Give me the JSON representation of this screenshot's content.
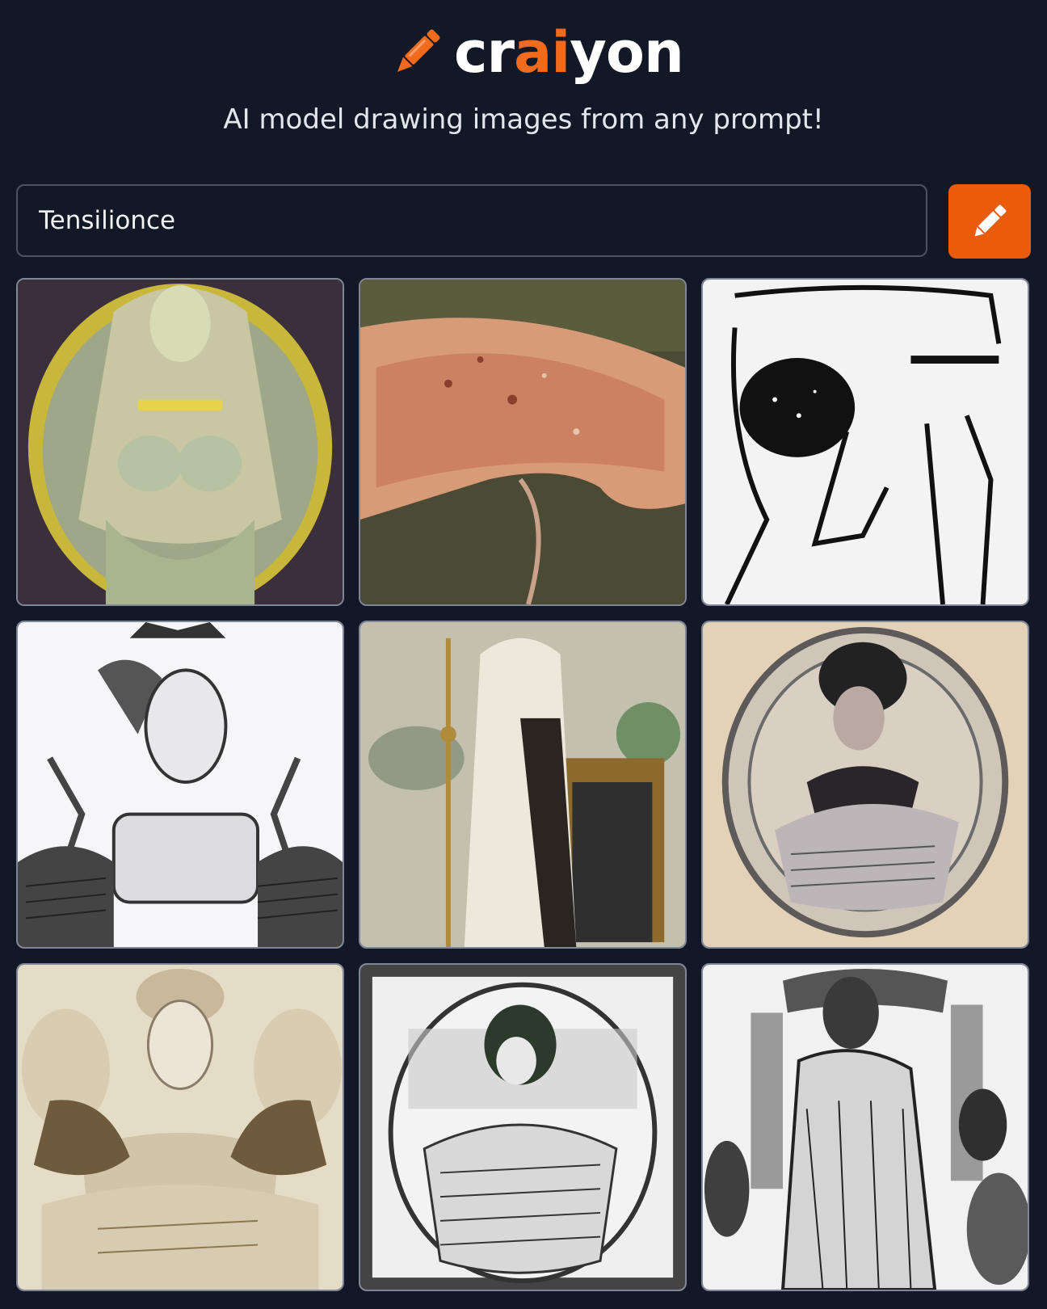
{
  "app": {
    "brand_prefix": "cr",
    "brand_accent": "ai",
    "brand_suffix": "yon",
    "tagline": "AI model drawing images from any prompt!",
    "logo_icon": "crayon-icon"
  },
  "search": {
    "value": "Tensilionce",
    "placeholder": "",
    "button_icon": "pencil-icon"
  },
  "colors": {
    "background": "#121826",
    "accent": "#ea5b0c",
    "tile_border": "#7f8796"
  },
  "results": [
    {
      "subject": "green woman in golden oval frame"
    },
    {
      "subject": "pinkish textured organic shape"
    },
    {
      "subject": "black line drawing with dark blot"
    },
    {
      "subject": "engraved figure with horns"
    },
    {
      "subject": "woman in white gown with staff"
    },
    {
      "subject": "oval portrait engraving of woman"
    },
    {
      "subject": "sepia drawing of woman with bows"
    },
    {
      "subject": "engraved portrait in ornate oval"
    },
    {
      "subject": "engraved classical scene with figures"
    }
  ]
}
